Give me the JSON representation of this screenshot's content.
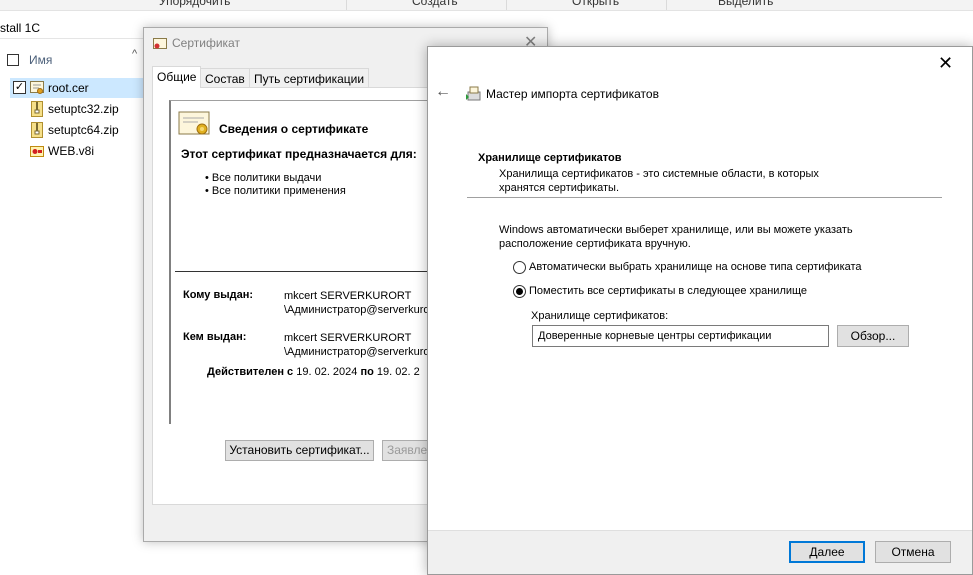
{
  "explorer": {
    "ribbon": [
      "Упорядочить",
      "Создать",
      "Открыть",
      "Выделить"
    ],
    "address": "stall 1C",
    "column_name": "Имя",
    "files": [
      {
        "name": "root.cer",
        "icon": "certificate-file-icon",
        "selected": true
      },
      {
        "name": "setuptc32.zip",
        "icon": "zip-file-icon",
        "selected": false
      },
      {
        "name": "setuptc64.zip",
        "icon": "zip-file-icon",
        "selected": false
      },
      {
        "name": "WEB.v8i",
        "icon": "v8i-file-icon",
        "selected": false
      }
    ]
  },
  "cert_dialog": {
    "title": "Сертификат",
    "tabs": [
      "Общие",
      "Состав",
      "Путь сертификации"
    ],
    "heading": "Сведения о сертификате",
    "purpose_title": "Этот сертификат предназначается для:",
    "purposes": [
      "• Все политики выдачи",
      "• Все политики применения"
    ],
    "issued_to_label": "Кому выдан:",
    "issued_to_value_1": "mkcert SERVERKURORT",
    "issued_to_value_2": "\\Администратор@serverkuro",
    "issued_by_label": "Кем выдан:",
    "issued_by_value_1": "mkcert SERVERKURORT",
    "issued_by_value_2": "\\Администратор@serverkuro",
    "valid_label": "Действителен с",
    "valid_from": "19. 02. 2024",
    "valid_to_label": "по",
    "valid_to": "19. 02. 2",
    "install_button": "Установить сертификат...",
    "statement_button": "Заявле"
  },
  "wizard": {
    "title": "Мастер импорта сертификатов",
    "section_title": "Хранилище сертификатов",
    "section_desc_1": "Хранилища сертификатов - это системные области, в которых",
    "section_desc_2": "хранятся сертификаты.",
    "text_1": "Windows автоматически выберет хранилище, или вы можете указать",
    "text_2": "расположение сертификата вручную.",
    "option_auto": "Автоматически выбрать хранилище на основе типа сертификата",
    "option_manual": "Поместить все сертификаты в следующее хранилище",
    "selected_option": "manual",
    "store_label": "Хранилище сертификатов:",
    "store_value": "Доверенные корневые центры сертификации",
    "browse_button": "Обзор...",
    "next_button": "Далее",
    "cancel_button": "Отмена"
  }
}
